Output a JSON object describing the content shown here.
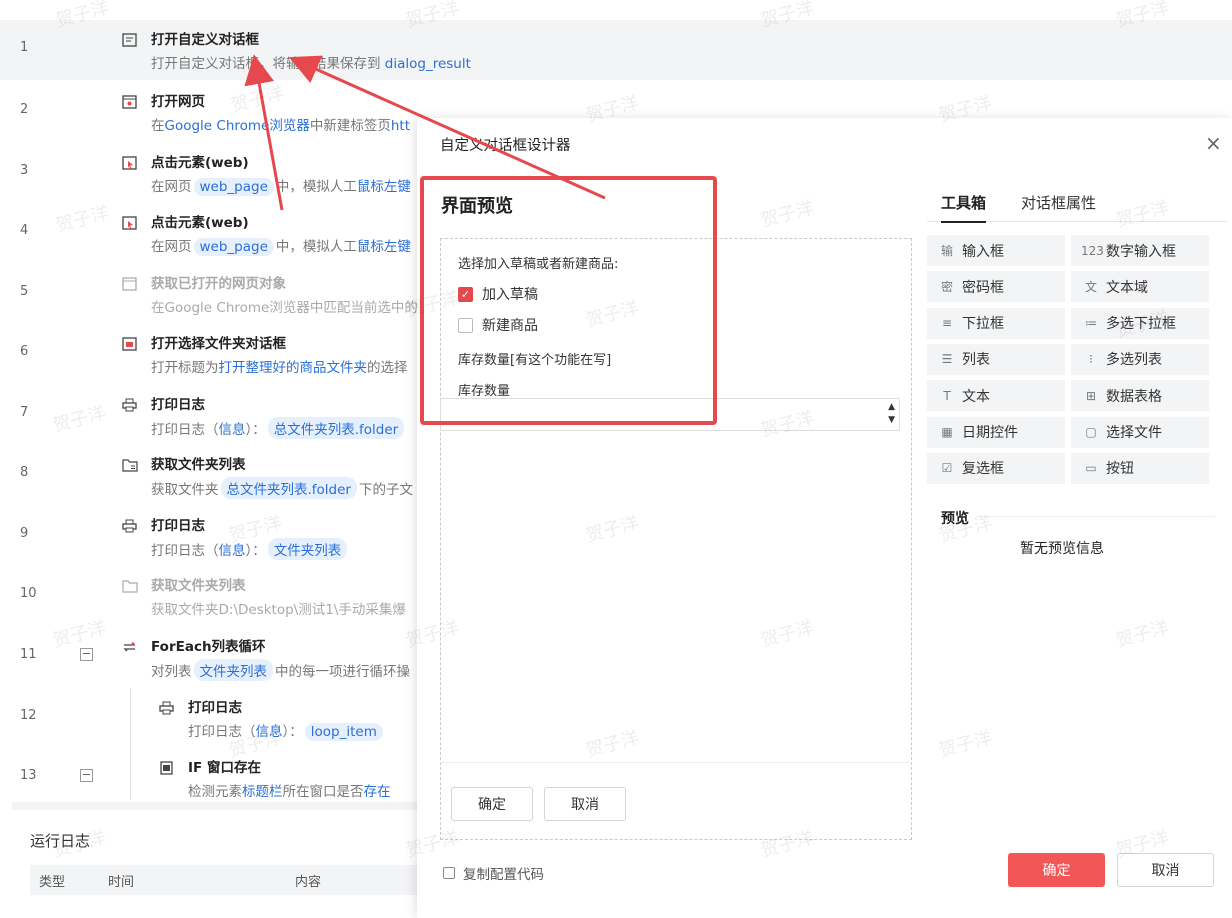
{
  "flow": {
    "rows": [
      {
        "num": "1",
        "title": "打开自定义对话框",
        "desc_a": "打开自定义对话框，将输入结果保存到",
        "chip": "dialog_result"
      },
      {
        "num": "2",
        "title": "打开网页",
        "desc_a": "在",
        "link": "Google Chrome浏览器",
        "desc_b": "中新建标签页",
        "link2": "htt"
      },
      {
        "num": "3",
        "title": "点击元素(web)",
        "desc_a": "在网页",
        "chip": "web_page",
        "desc_b": "中，模拟人工",
        "link": "鼠标左键"
      },
      {
        "num": "4",
        "title": "点击元素(web)",
        "desc_a": "在网页",
        "chip": "web_page",
        "desc_b": "中，模拟人工",
        "link": "鼠标左键"
      },
      {
        "num": "5",
        "title": "获取已打开的网页对象",
        "desc_a": "在Google Chrome浏览器中匹配当前选中的"
      },
      {
        "num": "6",
        "title": "打开选择文件夹对话框",
        "desc_a": "打开标题为",
        "link": "打开整理好的商品文件夹",
        "desc_b": "的选择"
      },
      {
        "num": "7",
        "title": "打印日志",
        "desc_a": "打印日志（",
        "link": "信息",
        "desc_b": "）：",
        "chip": "总文件夹列表.folder"
      },
      {
        "num": "8",
        "title": "获取文件夹列表",
        "desc_a": "获取文件夹",
        "chip": "总文件夹列表.folder",
        "desc_b": "下的子文"
      },
      {
        "num": "9",
        "title": "打印日志",
        "desc_a": "打印日志（",
        "link": "信息",
        "desc_b": "）：",
        "chip": "文件夹列表"
      },
      {
        "num": "10",
        "title": "获取文件夹列表",
        "desc_a": "获取文件夹D:\\Desktop\\测试1\\手动采集爆"
      },
      {
        "num": "11",
        "title": "ForEach列表循环",
        "desc_a": "对列表",
        "chip": "文件夹列表",
        "desc_b": "中的每一项进行循环操"
      },
      {
        "num": "12",
        "title": "打印日志",
        "desc_a": "打印日志（",
        "link": "信息",
        "desc_b": "）：",
        "chip": "loop_item"
      },
      {
        "num": "13",
        "title": "IF 窗口存在",
        "desc_a": "检测元素",
        "link": "标题栏",
        "desc_b": "所在窗口是否",
        "link2": "存在"
      }
    ],
    "collapse_symbol": "−"
  },
  "runlog": {
    "title": "运行日志",
    "columns": [
      "类型",
      "时间",
      "内容"
    ]
  },
  "modal": {
    "title": "自定义对话框设计器",
    "close": "×",
    "preview_heading": "界面预览",
    "form": {
      "question": "选择加入草稿或者新建商品:",
      "option1": "加入草稿",
      "option2": "新建商品",
      "stock_label1": "库存数量[有这个功能在写]",
      "stock_label2": "库存数量",
      "spin_up": "▲",
      "spin_down": "▼",
      "check": "✓"
    },
    "canvas_ok": "确定",
    "canvas_cancel": "取消",
    "copy_code": "复制配置代码",
    "ok": "确定",
    "cancel": "取消",
    "tabs": [
      "工具箱",
      "对话框属性"
    ],
    "tools": [
      {
        "icon": "输",
        "label": "输入框"
      },
      {
        "icon": "123",
        "label": "数字输入框"
      },
      {
        "icon": "密",
        "label": "密码框"
      },
      {
        "icon": "文",
        "label": "文本域"
      },
      {
        "icon": "≡",
        "label": "下拉框"
      },
      {
        "icon": "≔",
        "label": "多选下拉框"
      },
      {
        "icon": "☰",
        "label": "列表"
      },
      {
        "icon": "⁝",
        "label": "多选列表"
      },
      {
        "icon": "T",
        "label": "文本"
      },
      {
        "icon": "⊞",
        "label": "数据表格"
      },
      {
        "icon": "▦",
        "label": "日期控件"
      },
      {
        "icon": "▢",
        "label": "选择文件"
      },
      {
        "icon": "☑",
        "label": "复选框"
      },
      {
        "icon": "▭",
        "label": "按钮"
      }
    ],
    "preview_label": "预览",
    "preview_empty": "暂无预览信息"
  },
  "watermark": "贺子洋",
  "colors": {
    "accent": "#f25656",
    "link": "#2a6fd6",
    "highlight": "#e5484d"
  }
}
